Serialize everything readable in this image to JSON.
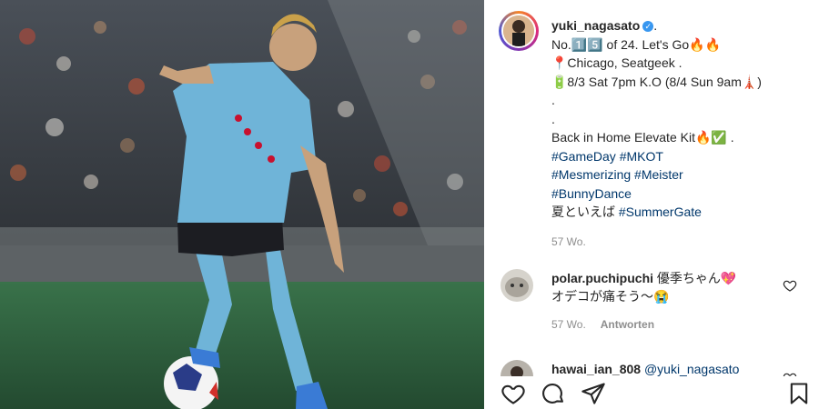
{
  "post": {
    "username": "yuki_nagasato",
    "verified_dot": ".",
    "caption_lines": [
      "No.1️⃣5️⃣ of 24. Let's Go🔥🔥",
      "📍Chicago, Seatgeek .",
      "🔋8/3 Sat 7pm K.O (8/4 Sun 9am🗼)",
      ".",
      ".",
      "Back in Home Elevate Kit🔥✅ ."
    ],
    "hashtag_lines": [
      "#GameDay #MKOT",
      "#Mesmerizing #Meister",
      "#BunnyDance"
    ],
    "last_line_prefix": "夏といえば ",
    "last_line_tag": "#SummerGate",
    "age": "57 Wo."
  },
  "comments": [
    {
      "username": "polar.puchipuchi",
      "text_line1": "優季ちゃん💖",
      "text_line2": "オデコが痛そう～😭",
      "age": "57 Wo.",
      "reply_label": "Antworten"
    },
    {
      "username": "hawai_ian_808",
      "mention": "@yuki_nagasato"
    }
  ],
  "icons": {
    "like": "heart-icon",
    "comment": "comment-icon",
    "share": "send-icon",
    "save": "bookmark-icon"
  },
  "colors": {
    "jersey": "#6fb4d8",
    "link": "#00376b",
    "verified": "#3897f0",
    "muted": "#8e8e8e"
  }
}
